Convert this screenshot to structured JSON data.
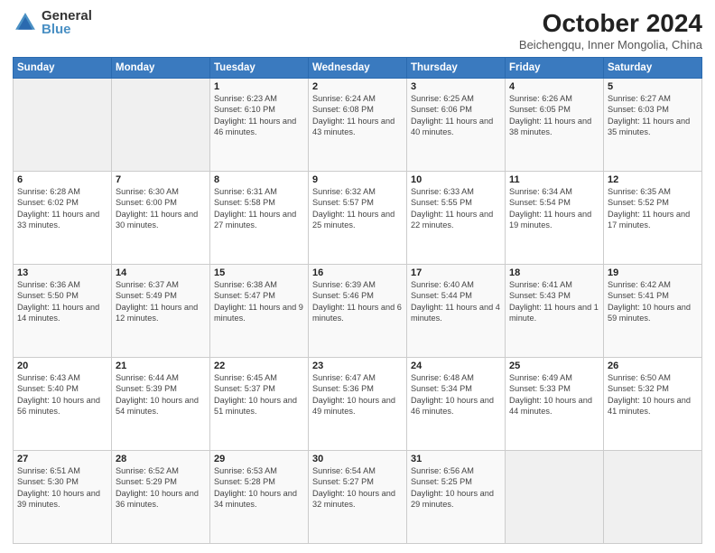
{
  "header": {
    "logo_general": "General",
    "logo_blue": "Blue",
    "title": "October 2024",
    "subtitle": "Beichengqu, Inner Mongolia, China"
  },
  "days_of_week": [
    "Sunday",
    "Monday",
    "Tuesday",
    "Wednesday",
    "Thursday",
    "Friday",
    "Saturday"
  ],
  "weeks": [
    [
      {
        "day": "",
        "empty": true
      },
      {
        "day": "",
        "empty": true
      },
      {
        "day": "1",
        "sunrise": "6:23 AM",
        "sunset": "6:10 PM",
        "daylight": "11 hours and 46 minutes."
      },
      {
        "day": "2",
        "sunrise": "6:24 AM",
        "sunset": "6:08 PM",
        "daylight": "11 hours and 43 minutes."
      },
      {
        "day": "3",
        "sunrise": "6:25 AM",
        "sunset": "6:06 PM",
        "daylight": "11 hours and 40 minutes."
      },
      {
        "day": "4",
        "sunrise": "6:26 AM",
        "sunset": "6:05 PM",
        "daylight": "11 hours and 38 minutes."
      },
      {
        "day": "5",
        "sunrise": "6:27 AM",
        "sunset": "6:03 PM",
        "daylight": "11 hours and 35 minutes."
      }
    ],
    [
      {
        "day": "6",
        "sunrise": "6:28 AM",
        "sunset": "6:02 PM",
        "daylight": "11 hours and 33 minutes."
      },
      {
        "day": "7",
        "sunrise": "6:30 AM",
        "sunset": "6:00 PM",
        "daylight": "11 hours and 30 minutes."
      },
      {
        "day": "8",
        "sunrise": "6:31 AM",
        "sunset": "5:58 PM",
        "daylight": "11 hours and 27 minutes."
      },
      {
        "day": "9",
        "sunrise": "6:32 AM",
        "sunset": "5:57 PM",
        "daylight": "11 hours and 25 minutes."
      },
      {
        "day": "10",
        "sunrise": "6:33 AM",
        "sunset": "5:55 PM",
        "daylight": "11 hours and 22 minutes."
      },
      {
        "day": "11",
        "sunrise": "6:34 AM",
        "sunset": "5:54 PM",
        "daylight": "11 hours and 19 minutes."
      },
      {
        "day": "12",
        "sunrise": "6:35 AM",
        "sunset": "5:52 PM",
        "daylight": "11 hours and 17 minutes."
      }
    ],
    [
      {
        "day": "13",
        "sunrise": "6:36 AM",
        "sunset": "5:50 PM",
        "daylight": "11 hours and 14 minutes."
      },
      {
        "day": "14",
        "sunrise": "6:37 AM",
        "sunset": "5:49 PM",
        "daylight": "11 hours and 12 minutes."
      },
      {
        "day": "15",
        "sunrise": "6:38 AM",
        "sunset": "5:47 PM",
        "daylight": "11 hours and 9 minutes."
      },
      {
        "day": "16",
        "sunrise": "6:39 AM",
        "sunset": "5:46 PM",
        "daylight": "11 hours and 6 minutes."
      },
      {
        "day": "17",
        "sunrise": "6:40 AM",
        "sunset": "5:44 PM",
        "daylight": "11 hours and 4 minutes."
      },
      {
        "day": "18",
        "sunrise": "6:41 AM",
        "sunset": "5:43 PM",
        "daylight": "11 hours and 1 minute."
      },
      {
        "day": "19",
        "sunrise": "6:42 AM",
        "sunset": "5:41 PM",
        "daylight": "10 hours and 59 minutes."
      }
    ],
    [
      {
        "day": "20",
        "sunrise": "6:43 AM",
        "sunset": "5:40 PM",
        "daylight": "10 hours and 56 minutes."
      },
      {
        "day": "21",
        "sunrise": "6:44 AM",
        "sunset": "5:39 PM",
        "daylight": "10 hours and 54 minutes."
      },
      {
        "day": "22",
        "sunrise": "6:45 AM",
        "sunset": "5:37 PM",
        "daylight": "10 hours and 51 minutes."
      },
      {
        "day": "23",
        "sunrise": "6:47 AM",
        "sunset": "5:36 PM",
        "daylight": "10 hours and 49 minutes."
      },
      {
        "day": "24",
        "sunrise": "6:48 AM",
        "sunset": "5:34 PM",
        "daylight": "10 hours and 46 minutes."
      },
      {
        "day": "25",
        "sunrise": "6:49 AM",
        "sunset": "5:33 PM",
        "daylight": "10 hours and 44 minutes."
      },
      {
        "day": "26",
        "sunrise": "6:50 AM",
        "sunset": "5:32 PM",
        "daylight": "10 hours and 41 minutes."
      }
    ],
    [
      {
        "day": "27",
        "sunrise": "6:51 AM",
        "sunset": "5:30 PM",
        "daylight": "10 hours and 39 minutes."
      },
      {
        "day": "28",
        "sunrise": "6:52 AM",
        "sunset": "5:29 PM",
        "daylight": "10 hours and 36 minutes."
      },
      {
        "day": "29",
        "sunrise": "6:53 AM",
        "sunset": "5:28 PM",
        "daylight": "10 hours and 34 minutes."
      },
      {
        "day": "30",
        "sunrise": "6:54 AM",
        "sunset": "5:27 PM",
        "daylight": "10 hours and 32 minutes."
      },
      {
        "day": "31",
        "sunrise": "6:56 AM",
        "sunset": "5:25 PM",
        "daylight": "10 hours and 29 minutes."
      },
      {
        "day": "",
        "empty": true
      },
      {
        "day": "",
        "empty": true
      }
    ]
  ]
}
